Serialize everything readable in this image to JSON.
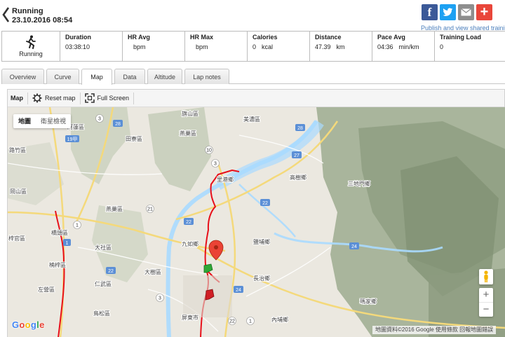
{
  "header": {
    "title": "Running",
    "date": "23.10.2016 08:54",
    "share_text": "Publish and view shared trainings",
    "share_buttons": [
      "facebook-icon",
      "twitter-icon",
      "email-icon",
      "plus-icon"
    ]
  },
  "stats": {
    "sport": "Running",
    "items": [
      {
        "label": "Duration",
        "value": "03:38:10",
        "unit": ""
      },
      {
        "label": "HR Avg",
        "value": "",
        "unit": "bpm"
      },
      {
        "label": "HR Max",
        "value": "",
        "unit": "bpm"
      },
      {
        "label": "Calories",
        "value": "0",
        "unit": "kcal"
      },
      {
        "label": "Distance",
        "value": "47.39",
        "unit": "km"
      },
      {
        "label": "Pace Avg",
        "value": "04:36",
        "unit": "min/km"
      },
      {
        "label": "Training Load",
        "value": "0",
        "unit": ""
      }
    ]
  },
  "tabs": [
    {
      "label": "Overview",
      "active": false
    },
    {
      "label": "Curve",
      "active": false
    },
    {
      "label": "Map",
      "active": true
    },
    {
      "label": "Data",
      "active": false
    },
    {
      "label": "Altitude",
      "active": false
    },
    {
      "label": "Lap notes",
      "active": false
    }
  ],
  "map_toolbar": {
    "title": "Map",
    "reset_label": "Reset map",
    "fullscreen_label": "Full Screen"
  },
  "map": {
    "type_map": "地圖",
    "type_satellite": "衛星檢視",
    "attribution": "地圖資料©2016 Google  使用條款  回報地圖錯誤",
    "logo": "Google",
    "zoom_in": "+",
    "zoom_out": "−",
    "route_color": "#e8101a",
    "start_marker_color": "#2fa836",
    "end_marker_color": "#d01f25",
    "place_labels": [
      "阿蓮區",
      "田寮區",
      "燕巢區",
      "旗山區",
      "美濃區",
      "路竹區",
      "岡山區",
      "高樹鄉",
      "三地門鄉",
      "里港鄉",
      "橋頭區",
      "燕巢區",
      "梓官區",
      "大社區",
      "九如鄉",
      "鹽埔鄉",
      "楠梓區",
      "大樹區",
      "長治鄉",
      "左營區",
      "仁武區",
      "瑪家鄉",
      "鳥松區",
      "屏東市",
      "內埔鄉"
    ],
    "highway_labels": [
      "28",
      "3",
      "19甲",
      "28",
      "10",
      "3",
      "22",
      "27",
      "21",
      "22",
      "1",
      "1",
      "22",
      "24",
      "24",
      "3",
      "22",
      "1"
    ]
  }
}
